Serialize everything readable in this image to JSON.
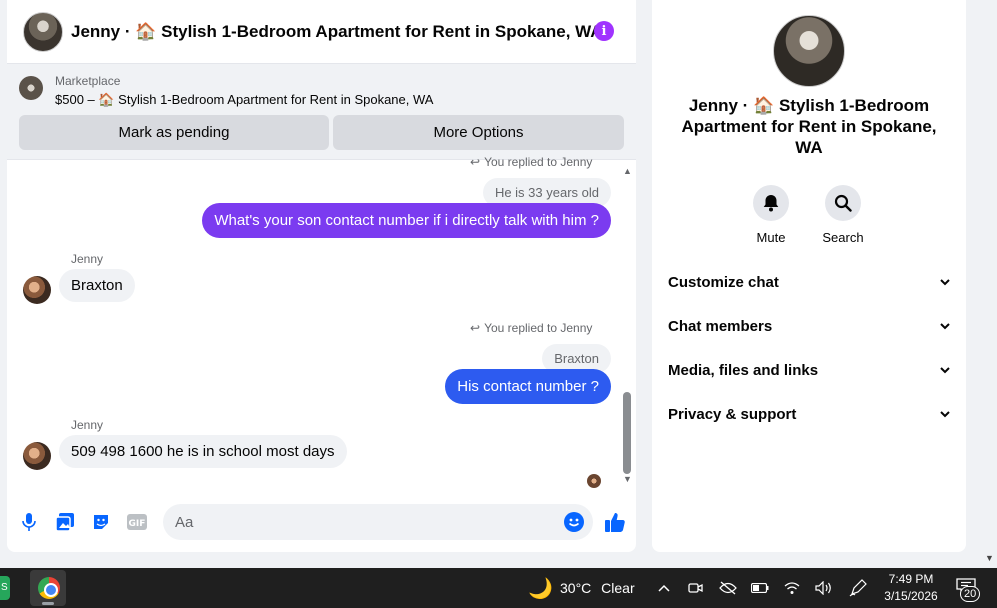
{
  "chat": {
    "title": "Jenny · 🏠 Stylish 1-Bedroom Apartment for Rent in Spokane, WA",
    "info_glyph": "i",
    "listing": {
      "source": "Marketplace",
      "name": "$500 – 🏠 Stylish 1-Bedroom Apartment for Rent in Spokane, WA",
      "mark_pending": "Mark as pending",
      "more_options": "More Options"
    },
    "messages": {
      "reply_label_1": "You replied to Jenny",
      "quoted_1": "He is 33 years old",
      "out_1": "What's your son contact number if i directly talk with him ?",
      "sender_1": "Jenny",
      "in_1": "Braxton",
      "reply_label_2": "You replied to Jenny",
      "quoted_2": "Braxton",
      "out_2": "His contact number ?",
      "sender_2": "Jenny",
      "in_2": "509 498 1600 he is in school most days"
    },
    "composer": {
      "placeholder": "Aa"
    }
  },
  "info": {
    "title": "Jenny · 🏠 Stylish 1-Bedroom Apartment for Rent in Spokane, WA",
    "actions": [
      {
        "label": "Mute",
        "icon": "bell-icon"
      },
      {
        "label": "Search",
        "icon": "search-icon"
      }
    ],
    "sections": [
      {
        "label": "Customize chat"
      },
      {
        "label": "Chat members"
      },
      {
        "label": "Media, files and links"
      },
      {
        "label": "Privacy & support"
      }
    ]
  },
  "taskbar": {
    "app_s_label": "S",
    "weather_temp": "30°C",
    "weather_desc": "Clear",
    "time": "7:49 PM",
    "date": "3/15/2026",
    "notifications": "20"
  },
  "colors": {
    "outgoing_bubble_1": "#7b3bf0",
    "outgoing_bubble_2": "#2d5bf0",
    "accent": "#0866ff",
    "info_purple": "#a033ff"
  }
}
